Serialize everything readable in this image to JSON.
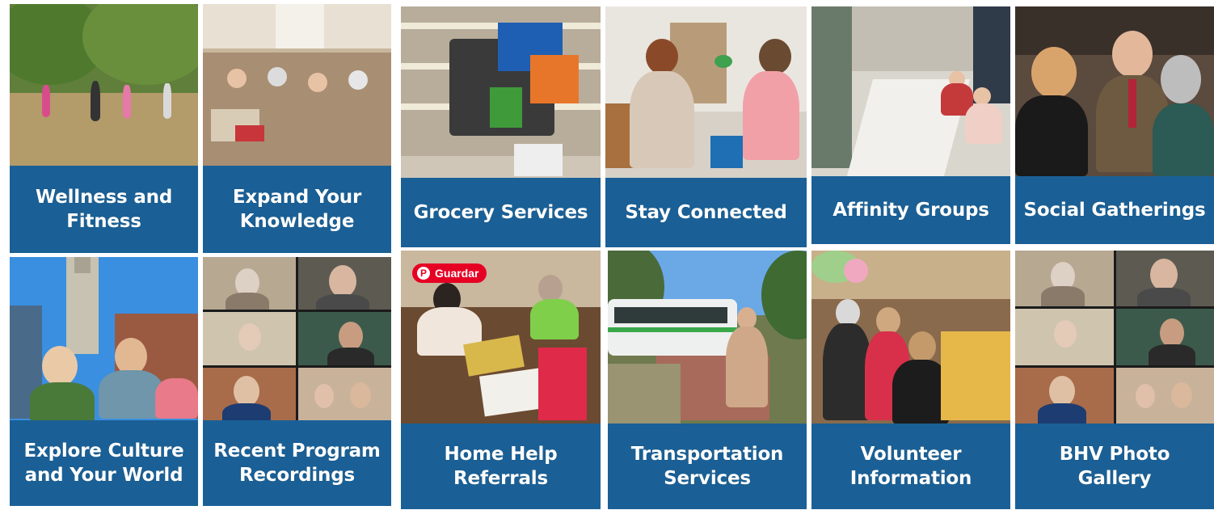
{
  "tiles": [
    {
      "label_1": "Wellness and",
      "label_2": "Fitness"
    },
    {
      "label_1": "Expand Your",
      "label_2": "Knowledge"
    },
    {
      "label_1": "Grocery Services"
    },
    {
      "label_1": "Stay Connected"
    },
    {
      "label_1": "Affinity Groups"
    },
    {
      "label_1": "Social Gatherings"
    },
    {
      "label_1": "Explore Culture",
      "label_2": "and Your World"
    },
    {
      "label_1": "Recent Program",
      "label_2": "Recordings"
    },
    {
      "label_1": "Home Help",
      "label_2": "Referrals"
    },
    {
      "label_1": "Transportation",
      "label_2": "Services"
    },
    {
      "label_1": "Volunteer",
      "label_2": "Information"
    },
    {
      "label_1": "BHV Photo",
      "label_2": "Gallery"
    }
  ],
  "pinterest": {
    "save_label": "Guardar",
    "icon": "pinterest-icon"
  },
  "colors": {
    "caption_bg": "#1a6096",
    "caption_text": "#ffffff",
    "pinterest_red": "#e60023"
  }
}
